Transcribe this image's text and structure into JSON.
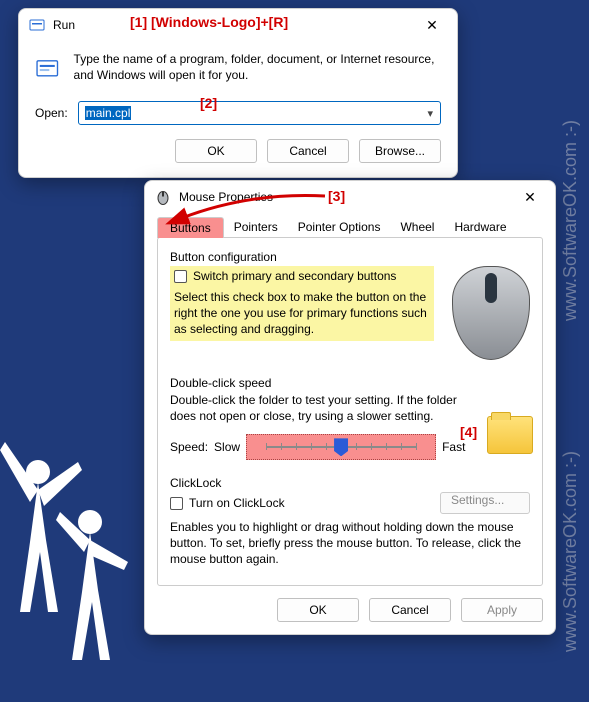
{
  "watermarks": {
    "horizontal": "www.SoftwareOK.com :-)",
    "vertical": "www.SoftwareOK.com :-)"
  },
  "annotations": {
    "a1": "[1] [Windows-Logo]+[R]",
    "a2": "[2]",
    "a3": "[3]",
    "a4": "[4]"
  },
  "run": {
    "title": "Run",
    "description": "Type the name of a program, folder, document, or Internet resource, and Windows will open it for you.",
    "open_label": "Open:",
    "input_value": "main.cpl",
    "buttons": {
      "ok": "OK",
      "cancel": "Cancel",
      "browse": "Browse..."
    }
  },
  "mouse": {
    "title": "Mouse Properties",
    "tabs": {
      "buttons": "Buttons",
      "pointers": "Pointers",
      "pointer_options": "Pointer Options",
      "wheel": "Wheel",
      "hardware": "Hardware"
    },
    "button_config": {
      "group_label": "Button configuration",
      "switch_label": "Switch primary and secondary buttons",
      "description": "Select this check box to make the button on the right the one you use for primary functions such as selecting and dragging."
    },
    "double_click": {
      "group_label": "Double-click speed",
      "description": "Double-click the folder to test your setting. If the folder does not open or close, try using a slower setting.",
      "speed_label": "Speed:",
      "slow": "Slow",
      "fast": "Fast"
    },
    "click_lock": {
      "group_label": "ClickLock",
      "checkbox_label": "Turn on ClickLock",
      "settings_btn": "Settings...",
      "description": "Enables you to highlight or drag without holding down the mouse button. To set, briefly press the mouse button. To release, click the mouse button again."
    },
    "buttons_row": {
      "ok": "OK",
      "cancel": "Cancel",
      "apply": "Apply"
    }
  }
}
